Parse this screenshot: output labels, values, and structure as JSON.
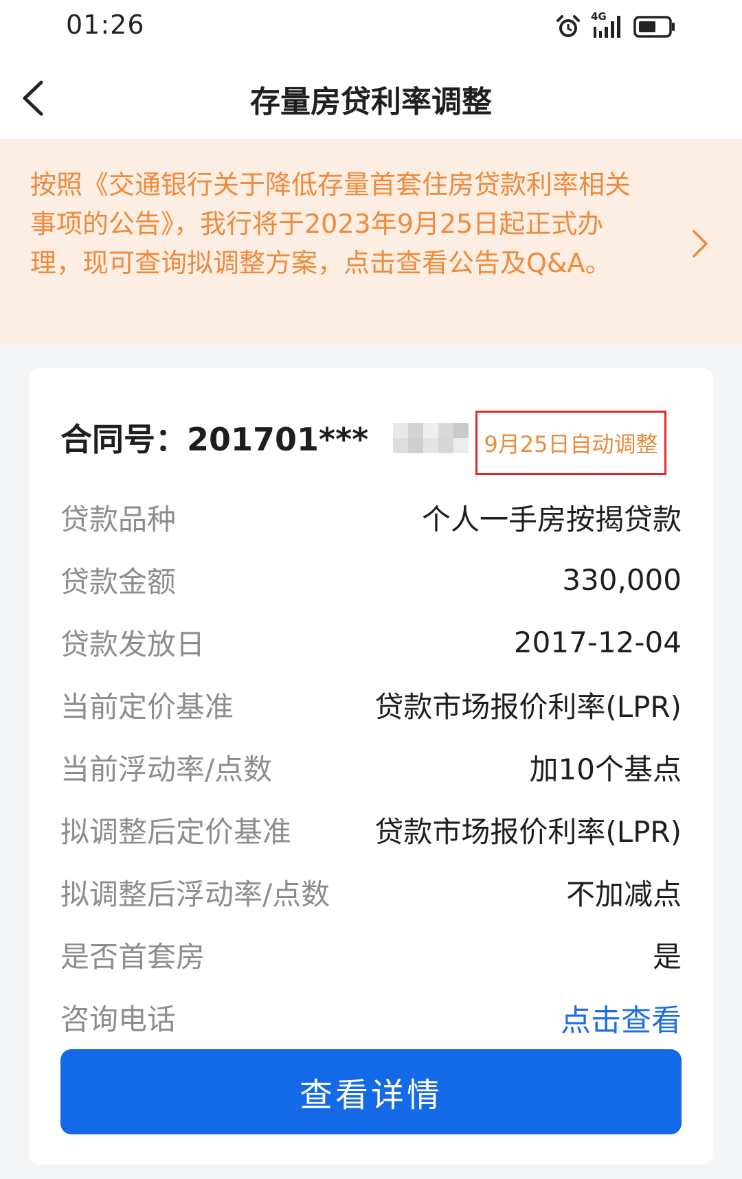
{
  "status_bar": {
    "time": "01:26",
    "network_label": "4G",
    "icons": [
      "alarm-icon",
      "signal-icon",
      "battery-icon"
    ]
  },
  "header": {
    "title": "存量房贷利率调整",
    "back_icon": "chevron-left-icon"
  },
  "notice": {
    "text": "按照《交通银行关于降低存量首套住房贷款利率相关事项的公告》，我行将于2023年9月25日起正式办理，现可查询拟调整方案，点击查看公告及Q&A。",
    "color": "#ee8a3b",
    "background": "#fdeee4"
  },
  "contract": {
    "label": "合同号：201701***",
    "badge": "9月25日自动调整",
    "badge_border_color": "#e5262a"
  },
  "info": [
    {
      "label": "贷款品种",
      "value": "个人一手房按揭贷款"
    },
    {
      "label": "贷款金额",
      "value": "330,000"
    },
    {
      "label": "贷款发放日",
      "value": "2017-12-04"
    },
    {
      "label": "当前定价基准",
      "value": "贷款市场报价利率(LPR)"
    },
    {
      "label": "当前浮动率/点数",
      "value": "加10个基点"
    },
    {
      "label": "拟调整后定价基准",
      "value": "贷款市场报价利率(LPR)"
    },
    {
      "label": "拟调整后浮动率/点数",
      "value": "不加减点"
    },
    {
      "label": "是否首套房",
      "value": "是"
    }
  ],
  "consult": {
    "label": "咨询电话",
    "link": "点击查看",
    "link_color": "#1d6fe0"
  },
  "detail_button": {
    "label": "查看详情",
    "color": "#1469e8"
  }
}
